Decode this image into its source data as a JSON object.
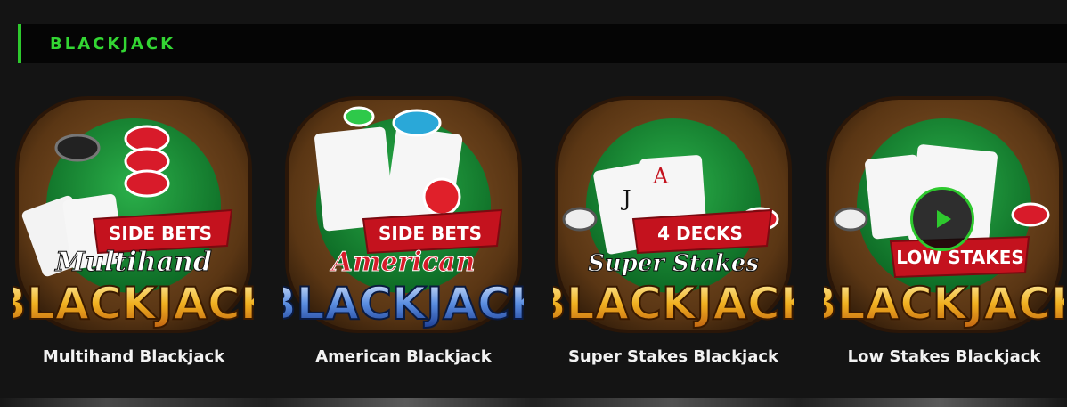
{
  "section": {
    "title": "BLACKJACK",
    "accent_color": "#2ec92e"
  },
  "games": [
    {
      "name": "Multihand Blackjack",
      "banner": "SIDE BETS",
      "subtitle": "Multihand",
      "wordmark": "BLACKJACK"
    },
    {
      "name": "American Blackjack",
      "banner": "SIDE BETS",
      "subtitle": "American",
      "wordmark": "BLACKJACK"
    },
    {
      "name": "Super Stakes Blackjack",
      "banner": "4 DECKS",
      "subtitle": "Super Stakes",
      "wordmark": "BLACKJACK"
    },
    {
      "name": "Low Stakes Blackjack",
      "banner": "LOW STAKES",
      "subtitle": "",
      "wordmark": "BLACKJACK"
    }
  ],
  "icons": {
    "play": "play-icon"
  }
}
